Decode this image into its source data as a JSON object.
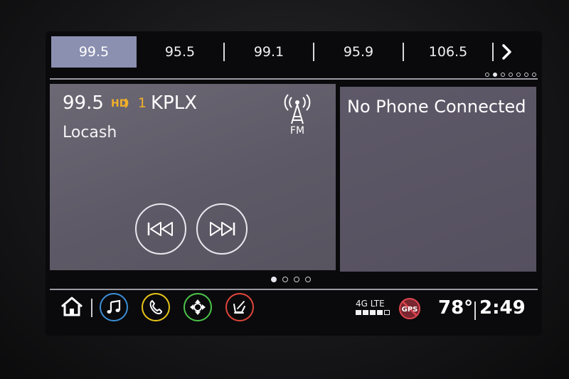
{
  "presets": {
    "items": [
      {
        "label": "99.5",
        "selected": true
      },
      {
        "label": "95.5",
        "selected": false
      },
      {
        "label": "99.1",
        "selected": false
      },
      {
        "label": "95.9",
        "selected": false
      },
      {
        "label": "106.5",
        "selected": false
      }
    ],
    "next_icon": "chevron-right-icon",
    "page_count": 7,
    "page_active": 2
  },
  "radio": {
    "frequency": "99.5",
    "hd_channel": "1",
    "station": "KPLX",
    "artist": "Locash",
    "band": "FM",
    "prev_icon": "seek-back-icon",
    "next_icon": "seek-forward-icon",
    "hd_color": "#f0b02a"
  },
  "phone": {
    "message": "No Phone Connected"
  },
  "home_pages": {
    "count": 4,
    "active": 1
  },
  "bottom_bar": {
    "apps": [
      {
        "name": "home-icon"
      },
      {
        "name": "music-icon",
        "color": "#3b8fd8"
      },
      {
        "name": "phone-icon",
        "color": "#e8c51a"
      },
      {
        "name": "nav-icon",
        "color": "#4cc54a"
      },
      {
        "name": "seat-icon",
        "color": "#e0463c"
      }
    ],
    "network": "4G LTE",
    "gps_label": "GPS",
    "temperature": "78°",
    "time": "2:49"
  }
}
